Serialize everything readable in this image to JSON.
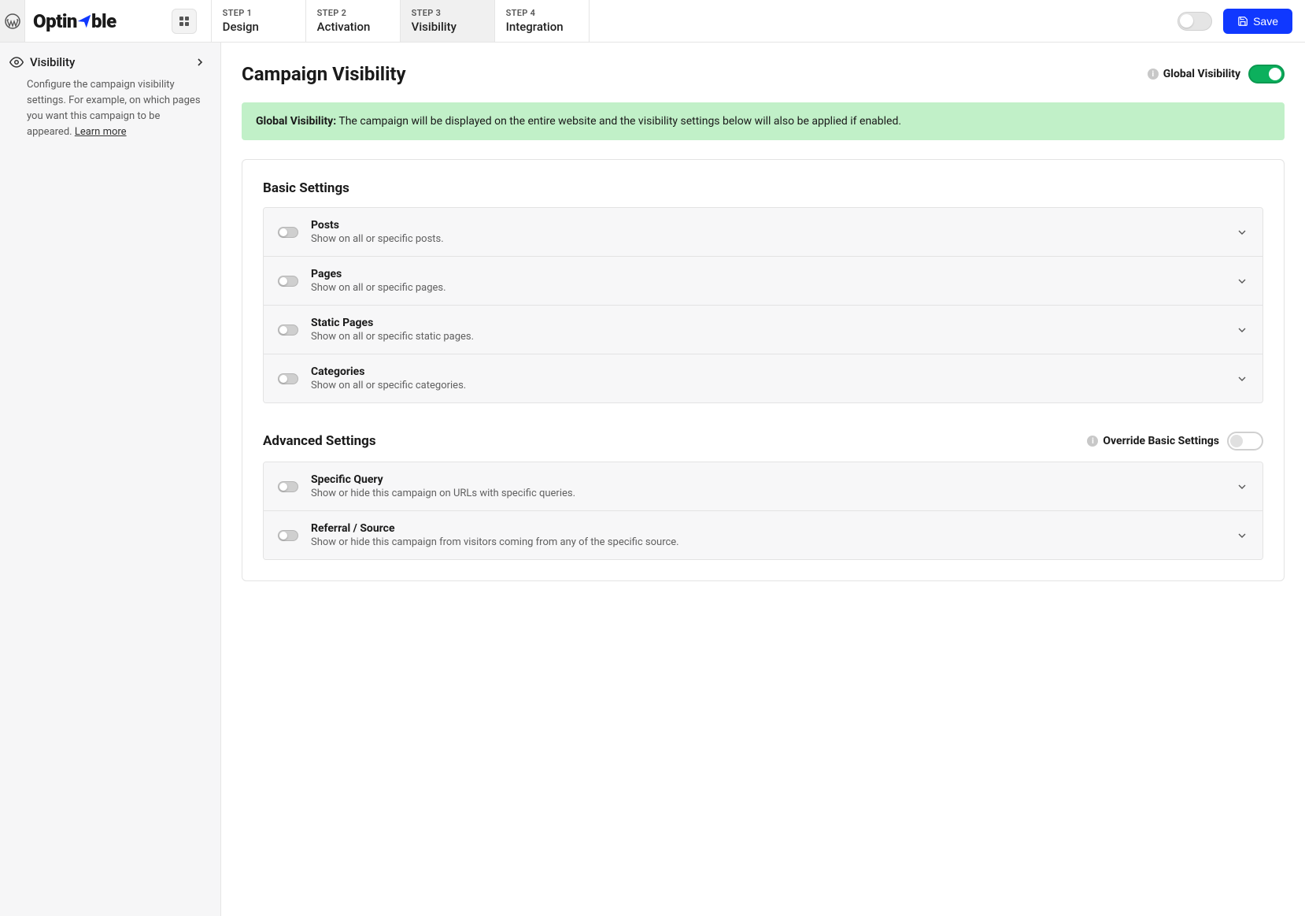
{
  "header": {
    "logo": "OptinAble",
    "steps": [
      {
        "label": "STEP 1",
        "name": "Design"
      },
      {
        "label": "STEP 2",
        "name": "Activation"
      },
      {
        "label": "STEP 3",
        "name": "Visibility"
      },
      {
        "label": "STEP 4",
        "name": "Integration"
      }
    ],
    "save_label": "Save"
  },
  "sidebar": {
    "title": "Visibility",
    "description": "Configure the campaign visibility settings. For example, on which pages you want this campaign to be appeared. ",
    "learn_more": "Learn more"
  },
  "main": {
    "title": "Campaign Visibility",
    "global_visibility_label": "Global Visibility",
    "notice_bold": "Global Visibility:",
    "notice_text": " The campaign will be displayed on the entire website and the visibility settings below will also be applied if enabled.",
    "basic_title": "Basic Settings",
    "basic_items": [
      {
        "name": "Posts",
        "desc": "Show on all or specific posts."
      },
      {
        "name": "Pages",
        "desc": "Show on all or specific pages."
      },
      {
        "name": "Static Pages",
        "desc": "Show on all or specific static pages."
      },
      {
        "name": "Categories",
        "desc": "Show on all or specific categories."
      }
    ],
    "advanced_title": "Advanced Settings",
    "override_label": "Override Basic Settings",
    "advanced_items": [
      {
        "name": "Specific Query",
        "desc": "Show or hide this campaign on URLs with specific queries."
      },
      {
        "name": "Referral / Source",
        "desc": "Show or hide this campaign from visitors coming from any of the specific source."
      }
    ]
  }
}
